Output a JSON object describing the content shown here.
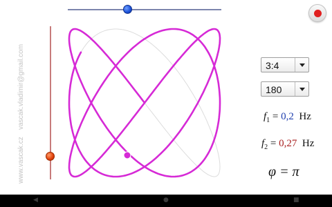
{
  "watermark": {
    "email": "vascak.vladimir@gmail.com",
    "website": "www.vascak.cz"
  },
  "controls": {
    "ratio": {
      "selected": "3:4"
    },
    "phase_select": {
      "selected": "180"
    }
  },
  "readouts": {
    "f1": {
      "symbol": "f",
      "subscript": "1",
      "equals": "=",
      "value": "0,2",
      "unit": "Hz"
    },
    "f2": {
      "symbol": "f",
      "subscript": "2",
      "equals": "=",
      "value": "0,27",
      "unit": "Hz"
    },
    "phase": {
      "text": "φ = π"
    }
  },
  "sliders": {
    "top": {
      "orientation": "horizontal",
      "knob_color": "#1a4fd8",
      "level": 0.39
    },
    "left": {
      "orientation": "vertical",
      "knob_color": "#e0400a",
      "level": 0.16
    }
  },
  "curve": {
    "ratio_a": 3,
    "ratio_b": 4,
    "phase": "pi",
    "color": "#d62ad6",
    "guide_color": "#dcdcdc"
  },
  "icons": {
    "record": "record-icon",
    "nav": [
      "back-icon",
      "home-icon",
      "recents-icon"
    ]
  }
}
